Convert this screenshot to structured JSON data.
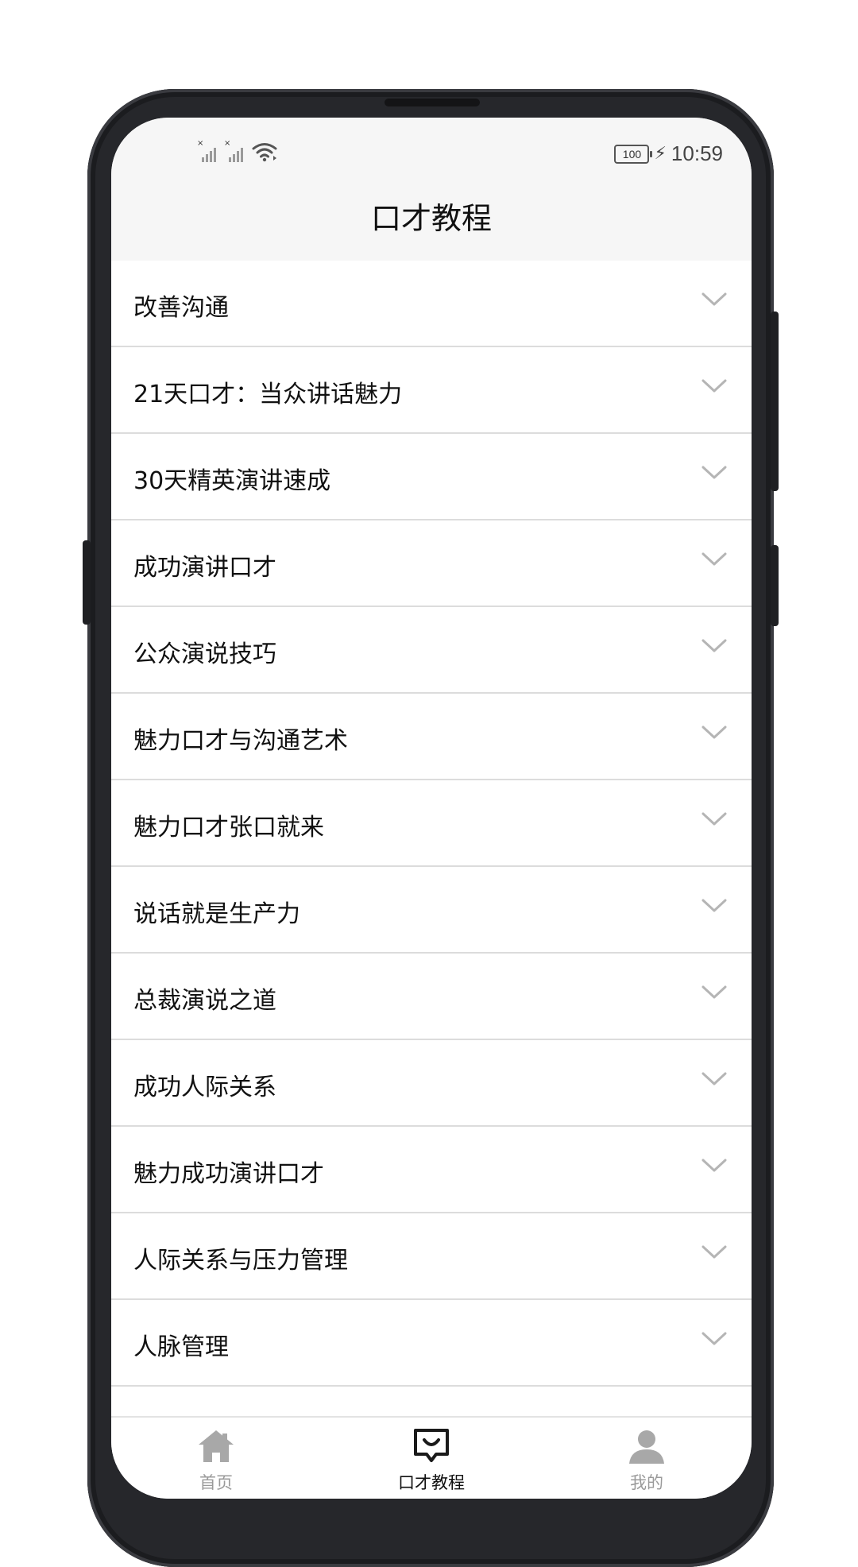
{
  "status_bar": {
    "battery": "100",
    "time": "10:59",
    "icons": [
      "signal-no-sim-icon",
      "signal-no-sim-icon",
      "wifi-icon",
      "battery-icon",
      "charging-icon"
    ]
  },
  "header": {
    "title": "口才教程"
  },
  "list": {
    "items": [
      {
        "label": "改善沟通"
      },
      {
        "label": "21天口才：当众讲话魅力"
      },
      {
        "label": "30天精英演讲速成"
      },
      {
        "label": "成功演讲口才"
      },
      {
        "label": "公众演说技巧"
      },
      {
        "label": "魅力口才与沟通艺术"
      },
      {
        "label": "魅力口才张口就来"
      },
      {
        "label": "说话就是生产力"
      },
      {
        "label": "总裁演说之道"
      },
      {
        "label": "成功人际关系"
      },
      {
        "label": "魅力成功演讲口才"
      },
      {
        "label": "人际关系与压力管理"
      },
      {
        "label": "人脉管理"
      }
    ],
    "expand_icon": "chevron-down-icon"
  },
  "tabbar": {
    "tabs": [
      {
        "label": "首页",
        "icon": "home-icon",
        "active": false
      },
      {
        "label": "口才教程",
        "icon": "chat-icon",
        "active": true
      },
      {
        "label": "我的",
        "icon": "user-icon",
        "active": false
      }
    ]
  },
  "colors": {
    "active_tab": "#111111",
    "inactive_tab": "#9a9a9a",
    "header_bg": "#f6f6f6",
    "divider": "#dcdcdc"
  }
}
